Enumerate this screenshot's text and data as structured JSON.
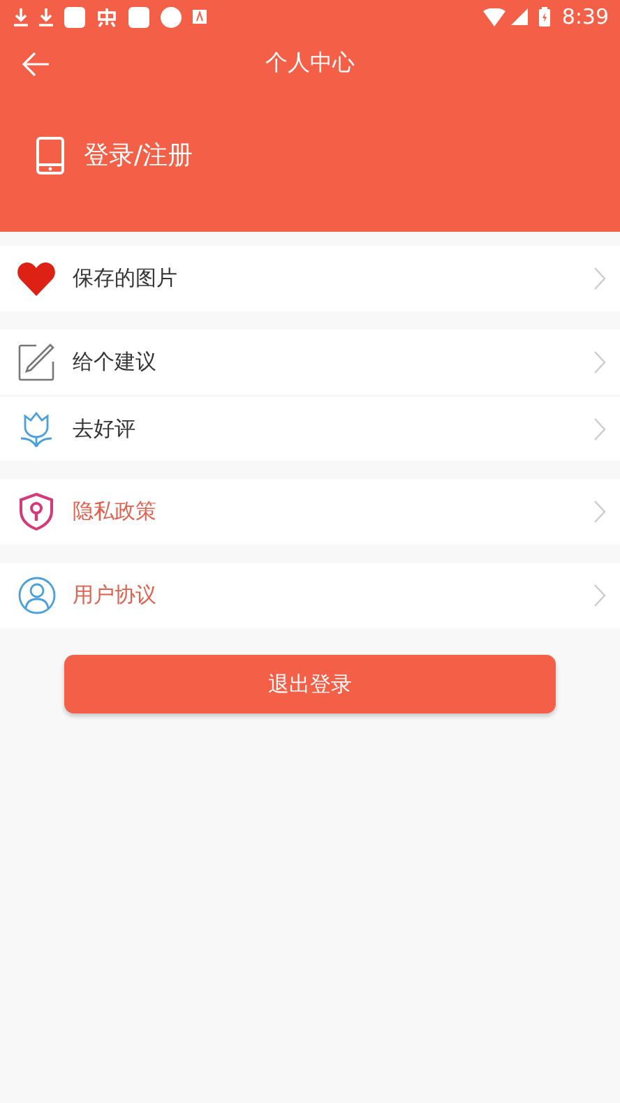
{
  "status_bar": {
    "time": "8:39"
  },
  "toolbar": {
    "title": "个人中心"
  },
  "login": {
    "label": "登录/注册"
  },
  "menu_groups": [
    {
      "items": [
        {
          "kind": "heart",
          "label": "保存的图片",
          "color": "#333333"
        }
      ]
    },
    {
      "items": [
        {
          "kind": "pencil",
          "label": "给个建议",
          "color": "#333333"
        },
        {
          "kind": "flower",
          "label": "去好评",
          "color": "#333333"
        }
      ]
    },
    {
      "items": [
        {
          "kind": "shield",
          "label": "隐私政策",
          "color": "#e0604d"
        }
      ]
    },
    {
      "items": [
        {
          "kind": "user",
          "label": "用户协议",
          "color": "#e0604d"
        }
      ]
    }
  ],
  "logout_button": {
    "label": "退出登录"
  }
}
